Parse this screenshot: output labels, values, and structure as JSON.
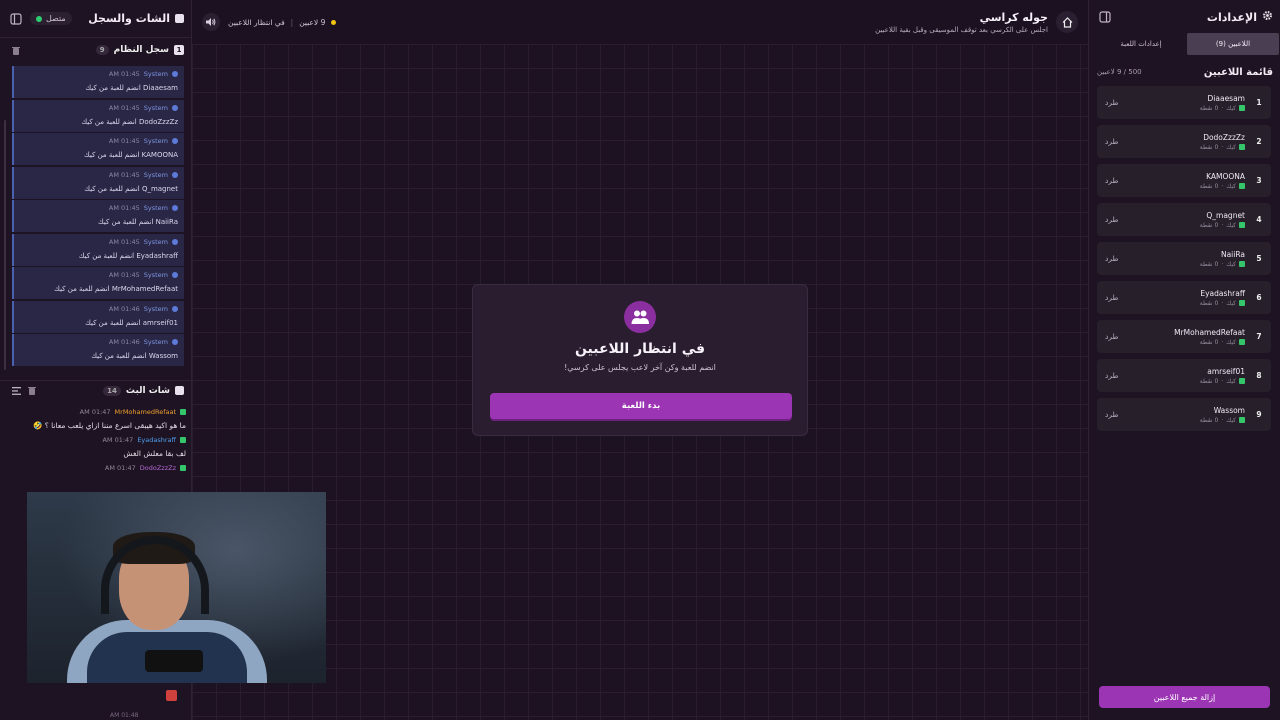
{
  "left_panel": {
    "title": "الشات والسجل",
    "status_label": "متصل",
    "system_log": {
      "title": "سجل النظام",
      "count": "9",
      "number": "1",
      "items": [
        {
          "who": "System",
          "time": "01:45 AM",
          "text": "Diaaesam انضم للعبة من كيك"
        },
        {
          "who": "System",
          "time": "01:45 AM",
          "text": "DodoZzzZz انضم للعبة من كيك"
        },
        {
          "who": "System",
          "time": "01:45 AM",
          "text": "KAMOONA انضم للعبة من كيك"
        },
        {
          "who": "System",
          "time": "01:45 AM",
          "text": "Q_magnet انضم للعبة من كيك"
        },
        {
          "who": "System",
          "time": "01:45 AM",
          "text": "NaiiRa انضم للعبة من كيك"
        },
        {
          "who": "System",
          "time": "01:45 AM",
          "text": "Eyadashraff انضم للعبة من كيك"
        },
        {
          "who": "System",
          "time": "01:45 AM",
          "text": "MrMohamedRefaat انضم للعبة من كيك"
        },
        {
          "who": "System",
          "time": "01:46 AM",
          "text": "amrseif01 انضم للعبة من كيك"
        },
        {
          "who": "System",
          "time": "01:46 AM",
          "text": "Wassom انضم للعبة من كيك"
        }
      ]
    },
    "live_chat": {
      "title": "شات البث",
      "count": "14",
      "messages": [
        {
          "user": "MrMohamedRefaat",
          "color": "#f0a030",
          "time": "01:47 AM",
          "text": "ما هو اكيد هيبقى اسرع مننا ازاي يلعب معانا ؟ 🤣"
        },
        {
          "user": "Eyadashraff",
          "color": "#4f9ff0",
          "time": "01:47 AM",
          "text": "لف بقا معلش الغش"
        },
        {
          "user": "DodoZzzZz",
          "color": "#b86ad8",
          "time": "01:47 AM",
          "text": ""
        }
      ],
      "tail_time": "01:48 AM"
    }
  },
  "top_bar": {
    "room_title": "جوله كراسي",
    "room_subtitle": "اجلس على الكرسي بعد توقف الموسيقى وقبل بقية اللاعبين",
    "players_count": "9 لاعبين",
    "state": "في انتظار اللاعبين"
  },
  "waiting_card": {
    "title": "في انتظار اللاعبين",
    "subtitle": "انضم للعبة وكن آخر لاعب يجلس على كرسي!",
    "start_button": "بدء اللعبة"
  },
  "right_panel": {
    "title": "الإعدادات",
    "tabs": [
      {
        "label": "اللاعبين (9)",
        "active": true
      },
      {
        "label": "إعدادات اللعبة",
        "active": false
      }
    ],
    "players_title": "قائمة اللاعبين",
    "capacity": "500 / 9 لاعبين",
    "kick_label": "طرد",
    "players": [
      {
        "rank": "1",
        "name": "Diaaesam",
        "source": "كيك",
        "points": "0 نقطة"
      },
      {
        "rank": "2",
        "name": "DodoZzzZz",
        "source": "كيك",
        "points": "0 نقطة"
      },
      {
        "rank": "3",
        "name": "KAMOONA",
        "source": "كيك",
        "points": "0 نقطة"
      },
      {
        "rank": "4",
        "name": "Q_magnet",
        "source": "كيك",
        "points": "0 نقطة"
      },
      {
        "rank": "5",
        "name": "NaiiRa",
        "source": "كيك",
        "points": "0 نقطة"
      },
      {
        "rank": "6",
        "name": "Eyadashraff",
        "source": "كيك",
        "points": "0 نقطة"
      },
      {
        "rank": "7",
        "name": "MrMohamedRefaat",
        "source": "كيك",
        "points": "0 نقطة"
      },
      {
        "rank": "8",
        "name": "amrseif01",
        "source": "كيك",
        "points": "0 نقطة"
      },
      {
        "rank": "9",
        "name": "Wassom",
        "source": "كيك",
        "points": "0 نقطة"
      }
    ],
    "remove_all_button": "إزالة جميع اللاعبين"
  },
  "colors": {
    "accent": "#9b35b3",
    "kick_green": "#35c66b",
    "background": "#1b1120"
  }
}
